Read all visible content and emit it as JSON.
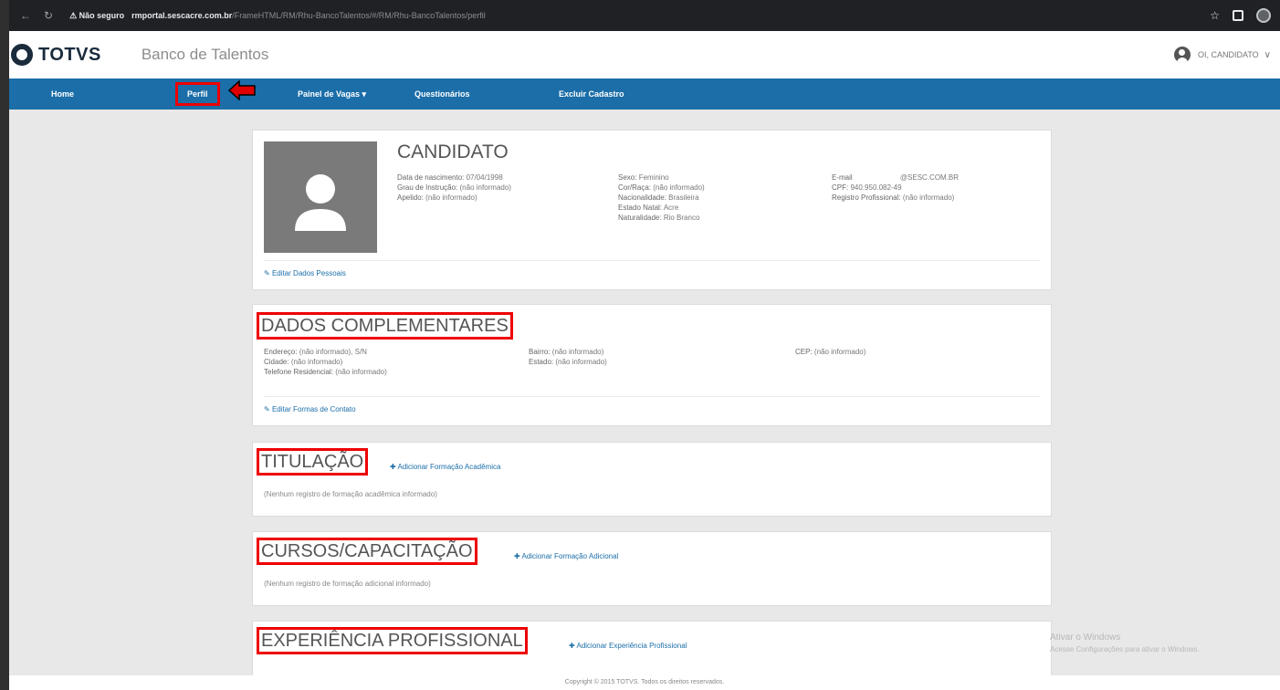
{
  "browser": {
    "url_warning": "⚠ Não seguro",
    "url_domain": "rmportal.sescacre.com.br",
    "url_path": "/FrameHTML/RM/Rhu-BancoTalentos/#/RM/Rhu-BancoTalentos/perfil"
  },
  "header": {
    "logo_text": "TOTVS",
    "app_title": "Banco de Talentos",
    "user_label": "OI, CANDIDATO"
  },
  "nav": {
    "items": [
      {
        "label": "Home"
      },
      {
        "label": "Perfil"
      },
      {
        "label": "Painel de Vagas ▾"
      },
      {
        "label": "Questionários"
      },
      {
        "label": "Excluir Cadastro"
      }
    ]
  },
  "profile": {
    "name": "CANDIDATO",
    "col1": [
      {
        "k": "Data de nascimento:",
        "v": "07/04/1998"
      },
      {
        "k": "Grau de Instrução:",
        "v": "(não informado)"
      },
      {
        "k": "Apelido:",
        "v": "(não informado)"
      }
    ],
    "col2": [
      {
        "k": "Sexo:",
        "v": "Feminino"
      },
      {
        "k": "Cor/Raça:",
        "v": "(não informado)"
      },
      {
        "k": "Nacionalidade:",
        "v": "Brasileira"
      },
      {
        "k": "Estado Natal:",
        "v": "Acre"
      },
      {
        "k": "Naturalidade:",
        "v": "Rio Branco"
      }
    ],
    "col3": [
      {
        "k": "E-mail",
        "v": "@SESC.COM.BR"
      },
      {
        "k": "CPF:",
        "v": "940.950.082-49"
      },
      {
        "k": "Registro Profissional:",
        "v": "(não informado)"
      }
    ],
    "edit_label": "Editar Dados Pessoais"
  },
  "complementares": {
    "title": "DADOS COMPLEMENTARES",
    "col1": [
      {
        "k": "Endereço:",
        "v": "(não informado), S/N"
      },
      {
        "k": "Cidade:",
        "v": "(não informado)"
      },
      {
        "k": "Telefone Residencial:",
        "v": "(não informado)"
      }
    ],
    "col2": [
      {
        "k": "Bairro:",
        "v": "(não informado)"
      },
      {
        "k": "Estado:",
        "v": "(não informado)"
      }
    ],
    "col3": [
      {
        "k": "CEP:",
        "v": "(não informado)"
      }
    ],
    "edit_label": "Editar Formas de Contato"
  },
  "titulacao": {
    "title": "TITULAÇÃO",
    "add_label": "Adicionar Formação Acadêmica",
    "empty_note": "(Nenhum registro de formação acadêmica informado)"
  },
  "cursos": {
    "title": "CURSOS/CAPACITAÇÃO",
    "add_label": "Adicionar Formação Adicional",
    "empty_note": "(Nenhum registro de formação adicional informado)"
  },
  "experiencia": {
    "title": "EXPERIÊNCIA PROFISSIONAL",
    "add_label": "Adicionar Experiência Profissional"
  },
  "watermark": {
    "title": "Ativar o Windows",
    "subtitle": "Acesse Configurações para ativar o Windows."
  },
  "footer": {
    "text": "Copyright © 2015 TOTVS. Todos os direitos reservados."
  },
  "colors": {
    "nav_bg": "#1b6ea8",
    "highlight": "#e00000",
    "link": "#1b6ea8"
  }
}
